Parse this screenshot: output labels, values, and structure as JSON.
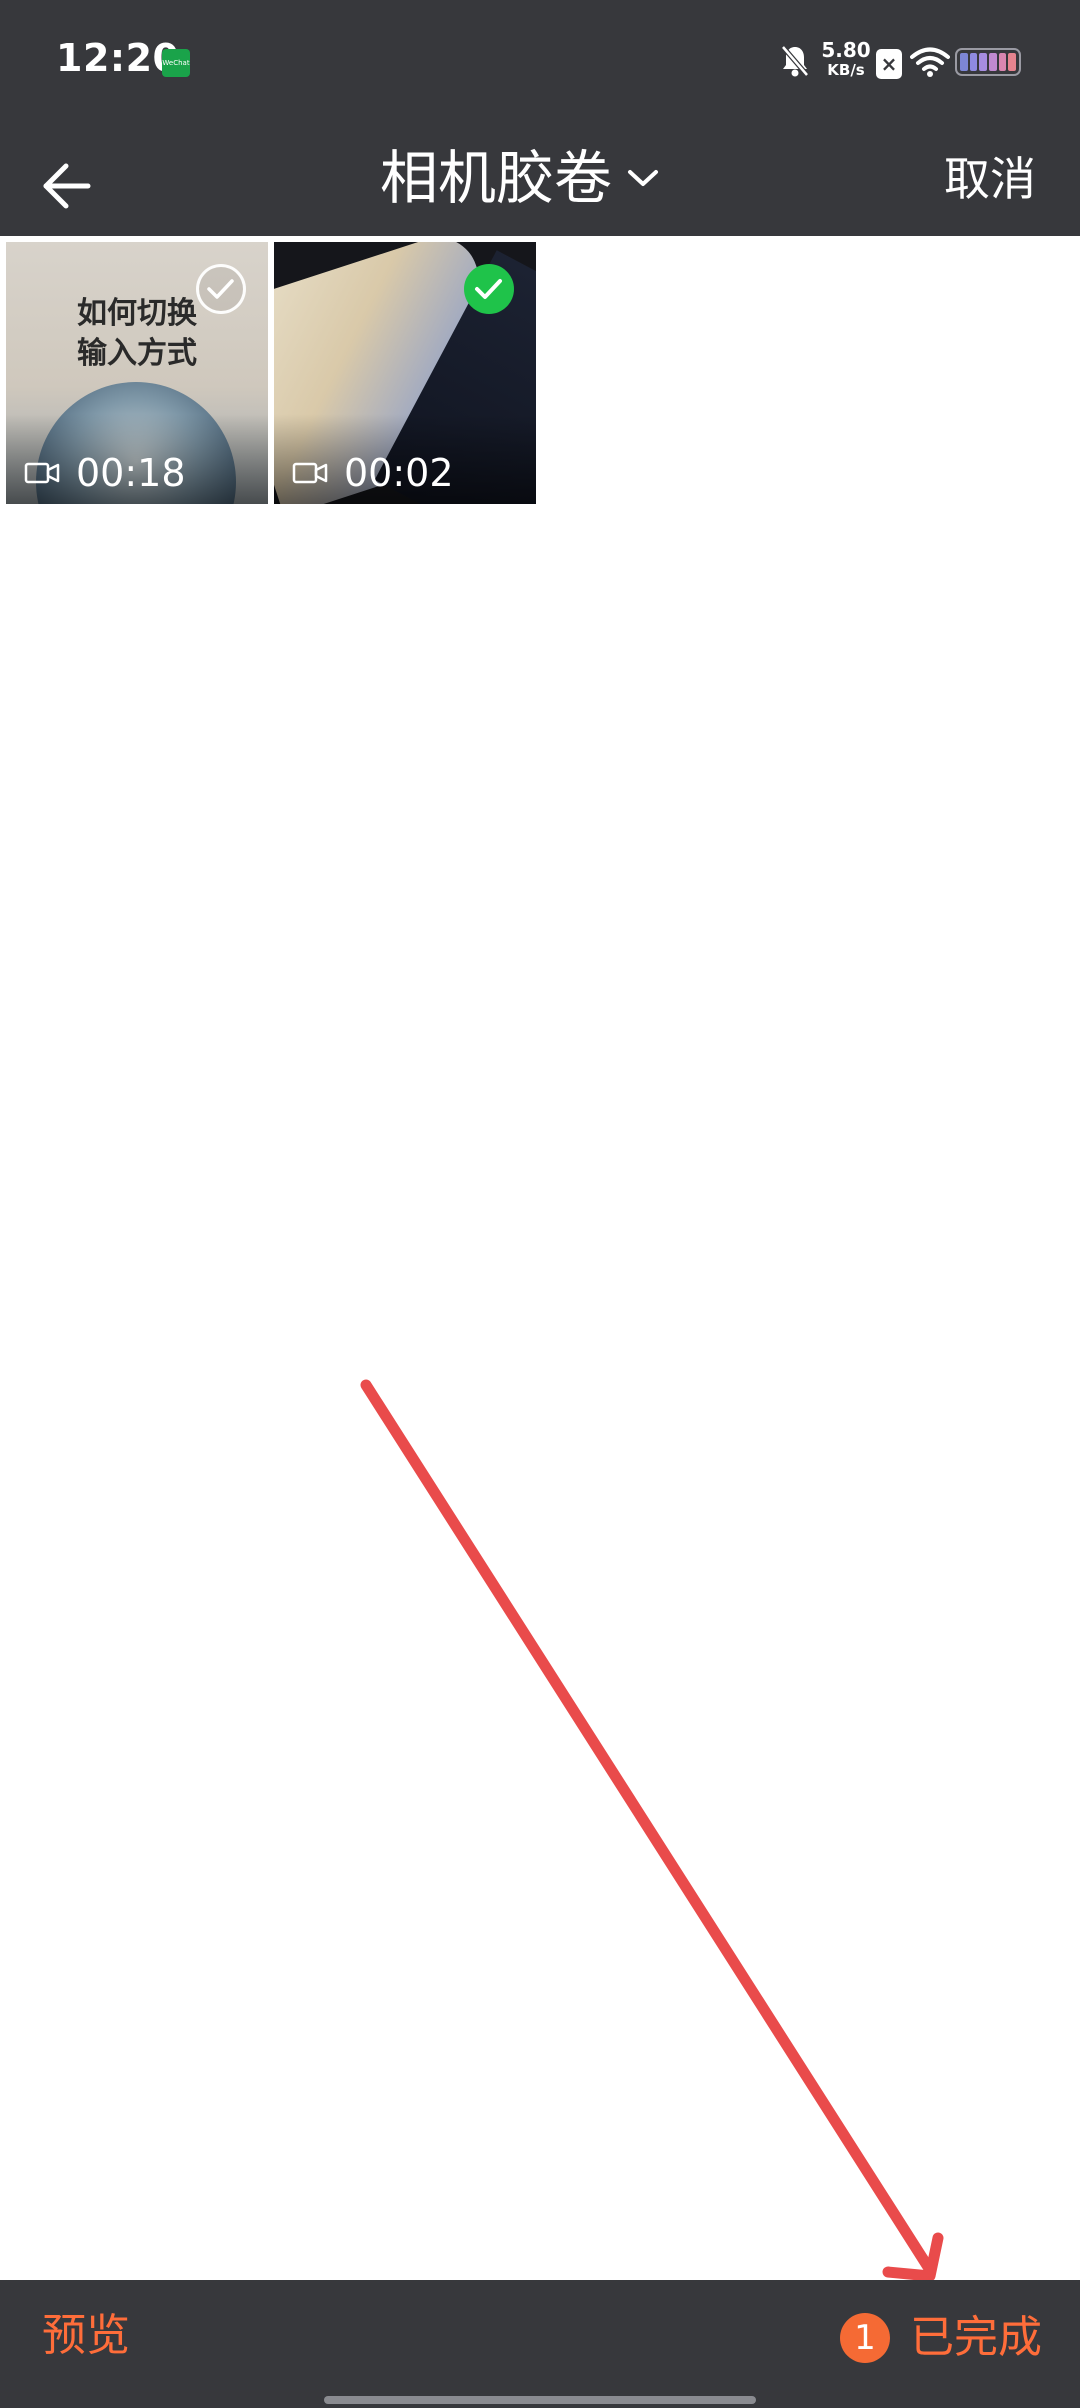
{
  "status_bar": {
    "time": "12:20",
    "app_badge": "WeChat",
    "net_speed_value": "5.80",
    "net_speed_unit": "KB/s",
    "extra_badge": "×",
    "icons": [
      "mute-bell-icon",
      "wifi-icon",
      "battery-icon"
    ]
  },
  "header": {
    "title": "相机胶卷",
    "cancel_label": "取消",
    "icons": [
      "back-arrow-icon",
      "chevron-down-icon"
    ]
  },
  "media": [
    {
      "caption": "如何切换\n输入方式",
      "duration": "00:18",
      "selected": false,
      "type": "video"
    },
    {
      "caption": "",
      "duration": "00:02",
      "selected": true,
      "type": "video"
    }
  ],
  "bottom_bar": {
    "preview_label": "预览",
    "selected_count": "1",
    "done_label": "已完成"
  },
  "colors": {
    "bar_bg": "#37383c",
    "accent_orange": "#ff6d3a",
    "check_green": "#1fc34a",
    "annotation_red": "#e94b4b"
  }
}
